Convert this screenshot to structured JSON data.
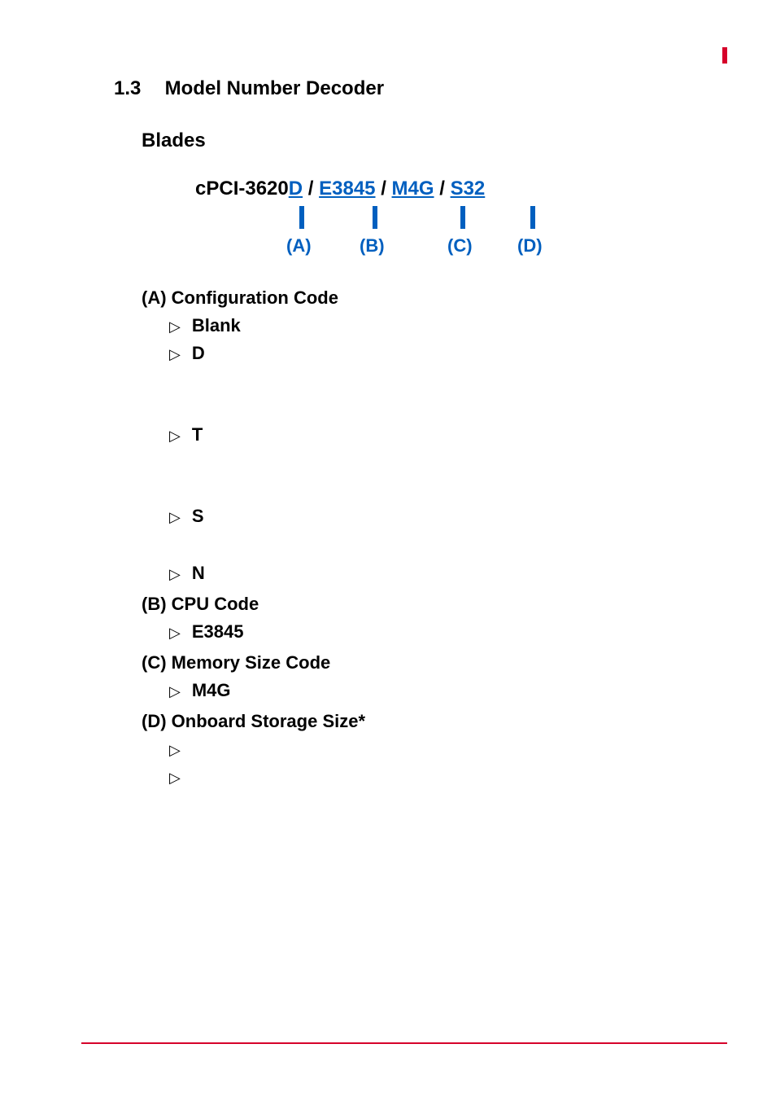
{
  "heading": {
    "number": "1.3",
    "title": "Model Number Decoder"
  },
  "subhead": "Blades",
  "model": {
    "prefix": "cPCI-3620",
    "parts": [
      "D",
      "E3845",
      "M4G",
      "S32"
    ],
    "legend": [
      "(A)",
      "(B)",
      "(C)",
      "(D)"
    ]
  },
  "sections": {
    "a": {
      "label": "(A) Configuration Code",
      "items": [
        "Blank",
        "D",
        "T",
        "S",
        "N"
      ]
    },
    "b": {
      "label": "(B) CPU Code",
      "items": [
        "E3845"
      ]
    },
    "c": {
      "label": "(C) Memory Size Code",
      "items": [
        "M4G"
      ]
    },
    "d": {
      "label": "(D) Onboard Storage Size*",
      "items": [
        "",
        ""
      ]
    }
  }
}
